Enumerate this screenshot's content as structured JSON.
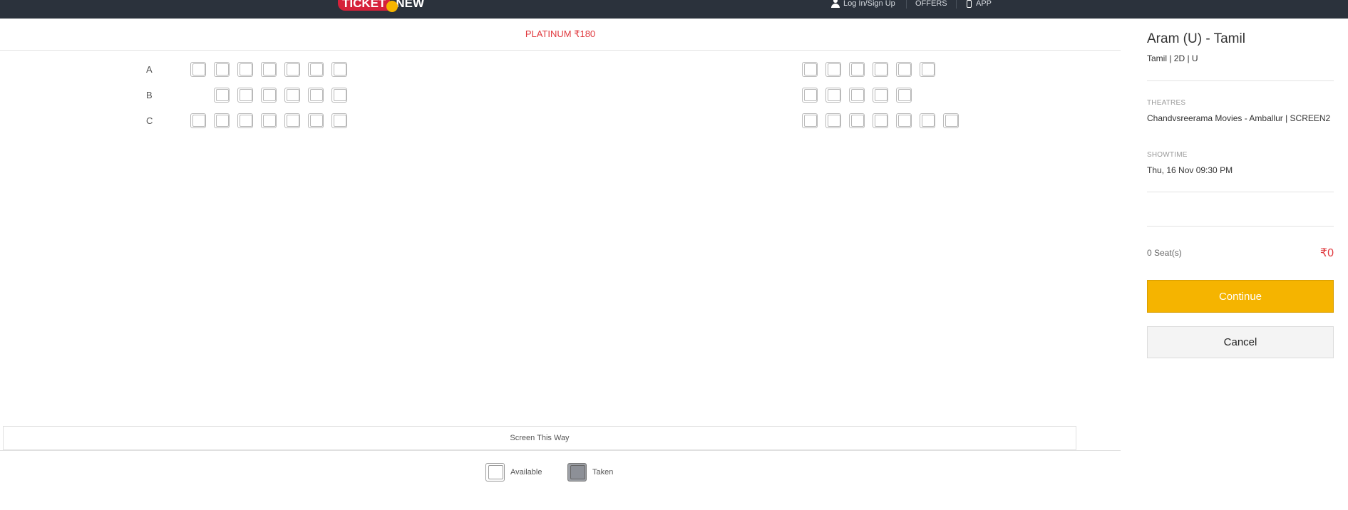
{
  "header": {
    "logo_text_left": "TICKET",
    "logo_text_right": "NEW",
    "login_label": "Log In/Sign Up",
    "offers_label": "OFFERS",
    "app_label": "APP"
  },
  "seat_map": {
    "category_label": "PLATINUM ₹180",
    "rows": [
      {
        "label": "A",
        "left_block_seats": 7,
        "left_block_start_empty": 0,
        "right_block_seats": 6
      },
      {
        "label": "B",
        "left_block_seats": 6,
        "left_block_start_empty": 1,
        "right_block_seats": 5
      },
      {
        "label": "C",
        "left_block_seats": 7,
        "left_block_start_empty": 0,
        "right_block_seats": 7
      }
    ],
    "screen_label": "Screen This Way"
  },
  "legend": {
    "available_label": "Available",
    "taken_label": "Taken"
  },
  "summary": {
    "movie_title": "Aram (U) - Tamil",
    "movie_meta": "Tamil | 2D | U",
    "theatres_label": "THEATRES",
    "theatre_value": "Chandvsreerama Movies - Amballur | SCREEN2",
    "showtime_label": "SHOWTIME",
    "showtime_value": "Thu, 16 Nov 09:30 PM",
    "seats_count": "0 Seat(s)",
    "total_price": "₹0",
    "continue_label": "Continue",
    "cancel_label": "Cancel"
  },
  "colors": {
    "accent_red": "#e0393e",
    "continue_yellow": "#f5b400",
    "topbar": "#2b323c"
  }
}
